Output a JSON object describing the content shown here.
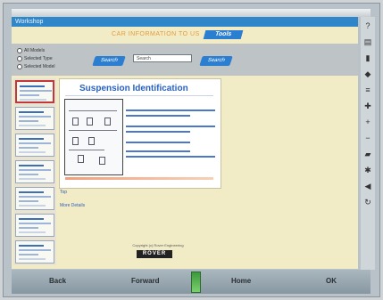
{
  "window": {
    "title": "Workshop"
  },
  "banner": {
    "text": "CAR INFORMATION TO US",
    "badge": "Tools"
  },
  "options": [
    {
      "label": "All Models"
    },
    {
      "label": "Selected Type"
    },
    {
      "label": "Selected Model"
    }
  ],
  "toolbar": {
    "pill_left": "Search",
    "pill_right": "Search",
    "dropdown": "Search"
  },
  "page": {
    "title": "Suspension Identification"
  },
  "links": [
    {
      "label": "Top"
    },
    {
      "label": "More Details"
    }
  ],
  "credit": {
    "line": "Copyright (c) Rover Engineering",
    "logo": "ROVER"
  },
  "right_toolbar": {
    "icons": [
      "help-icon",
      "print-icon",
      "bookmark-icon",
      "pin-icon",
      "list-icon",
      "tools-icon",
      "zoom-in-icon",
      "zoom-out-icon",
      "car-icon",
      "gear-icon",
      "back-icon",
      "refresh-icon"
    ]
  },
  "nav": {
    "back": "Back",
    "forward": "Forward",
    "home": "Home",
    "ok": "OK"
  },
  "colors": {
    "title_bar": "#2f86c8",
    "content_bg": "#f2ecc6",
    "accent": "#2c7fd0"
  }
}
